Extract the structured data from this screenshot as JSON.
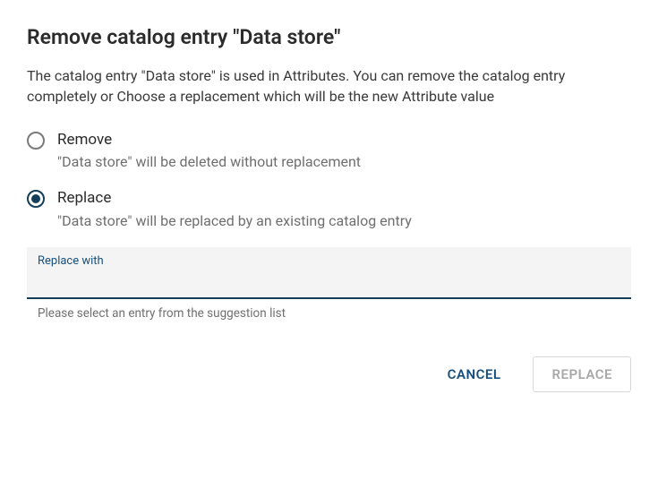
{
  "dialog": {
    "title": "Remove catalog entry \"Data store\"",
    "description": "The catalog entry \"Data store\" is used in Attributes. You can remove the catalog entry completely or Choose a replacement which will be the new Attribute value"
  },
  "options": {
    "remove": {
      "label": "Remove",
      "hint": "\"Data store\" will be deleted without replacement",
      "selected": false
    },
    "replace": {
      "label": "Replace",
      "hint": "\"Data store\" will be replaced by an existing catalog entry",
      "selected": true
    }
  },
  "field": {
    "label": "Replace with",
    "value": "",
    "helper": "Please select an entry from the suggestion list"
  },
  "actions": {
    "cancel": "CANCEL",
    "confirm": "REPLACE"
  },
  "colors": {
    "accent": "#163e59"
  }
}
